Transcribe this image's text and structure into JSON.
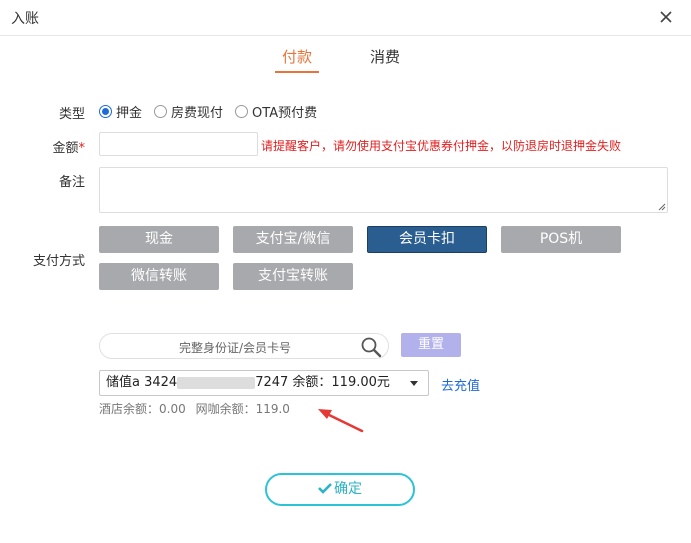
{
  "dialog": {
    "title": "入账"
  },
  "tabs": [
    {
      "label": "付款",
      "active": true
    },
    {
      "label": "消费",
      "active": false
    }
  ],
  "form": {
    "type_label": "类型",
    "type_options": [
      {
        "label": "押金",
        "selected": true
      },
      {
        "label": "房费现付",
        "selected": false
      },
      {
        "label": "OTA预付费",
        "selected": false
      }
    ],
    "amount_label": "金额",
    "amount_required_mark": "*",
    "amount_value": "",
    "amount_note": "请提醒客户，请勿使用支付宝优惠券付押金，以防退房时退押金失败",
    "remark_label": "备注",
    "remark_value": "",
    "payment_label": "支付方式",
    "payment_methods": [
      {
        "label": "现金",
        "active": false
      },
      {
        "label": "支付宝/微信",
        "active": false
      },
      {
        "label": "会员卡扣",
        "active": true
      },
      {
        "label": "POS机",
        "active": false
      },
      {
        "label": "微信转账",
        "active": false
      },
      {
        "label": "支付宝转账",
        "active": false
      }
    ]
  },
  "member": {
    "search_placeholder": "完整身份证/会员卡号",
    "reset_label": "重置",
    "selected_card_prefix": "储值a  3424",
    "selected_card_suffix": "7247 余额：119.00元",
    "recharge_label": "去充值",
    "hotel_balance": "酒店余额：0.00",
    "netcafe_balance": "网咖余额：119.0"
  },
  "confirm_label": "确定",
  "colors": {
    "tab_active": "#e8743b",
    "pay_active": "#2a5d90",
    "pay_inactive": "#a8a9ad",
    "warning": "#e02020",
    "link": "#1e6bd6",
    "confirm": "#2bc3d6",
    "reset": "#b3b1ec"
  },
  "icons": [
    "close-icon",
    "search-icon",
    "check-icon",
    "annotation-arrow"
  ]
}
